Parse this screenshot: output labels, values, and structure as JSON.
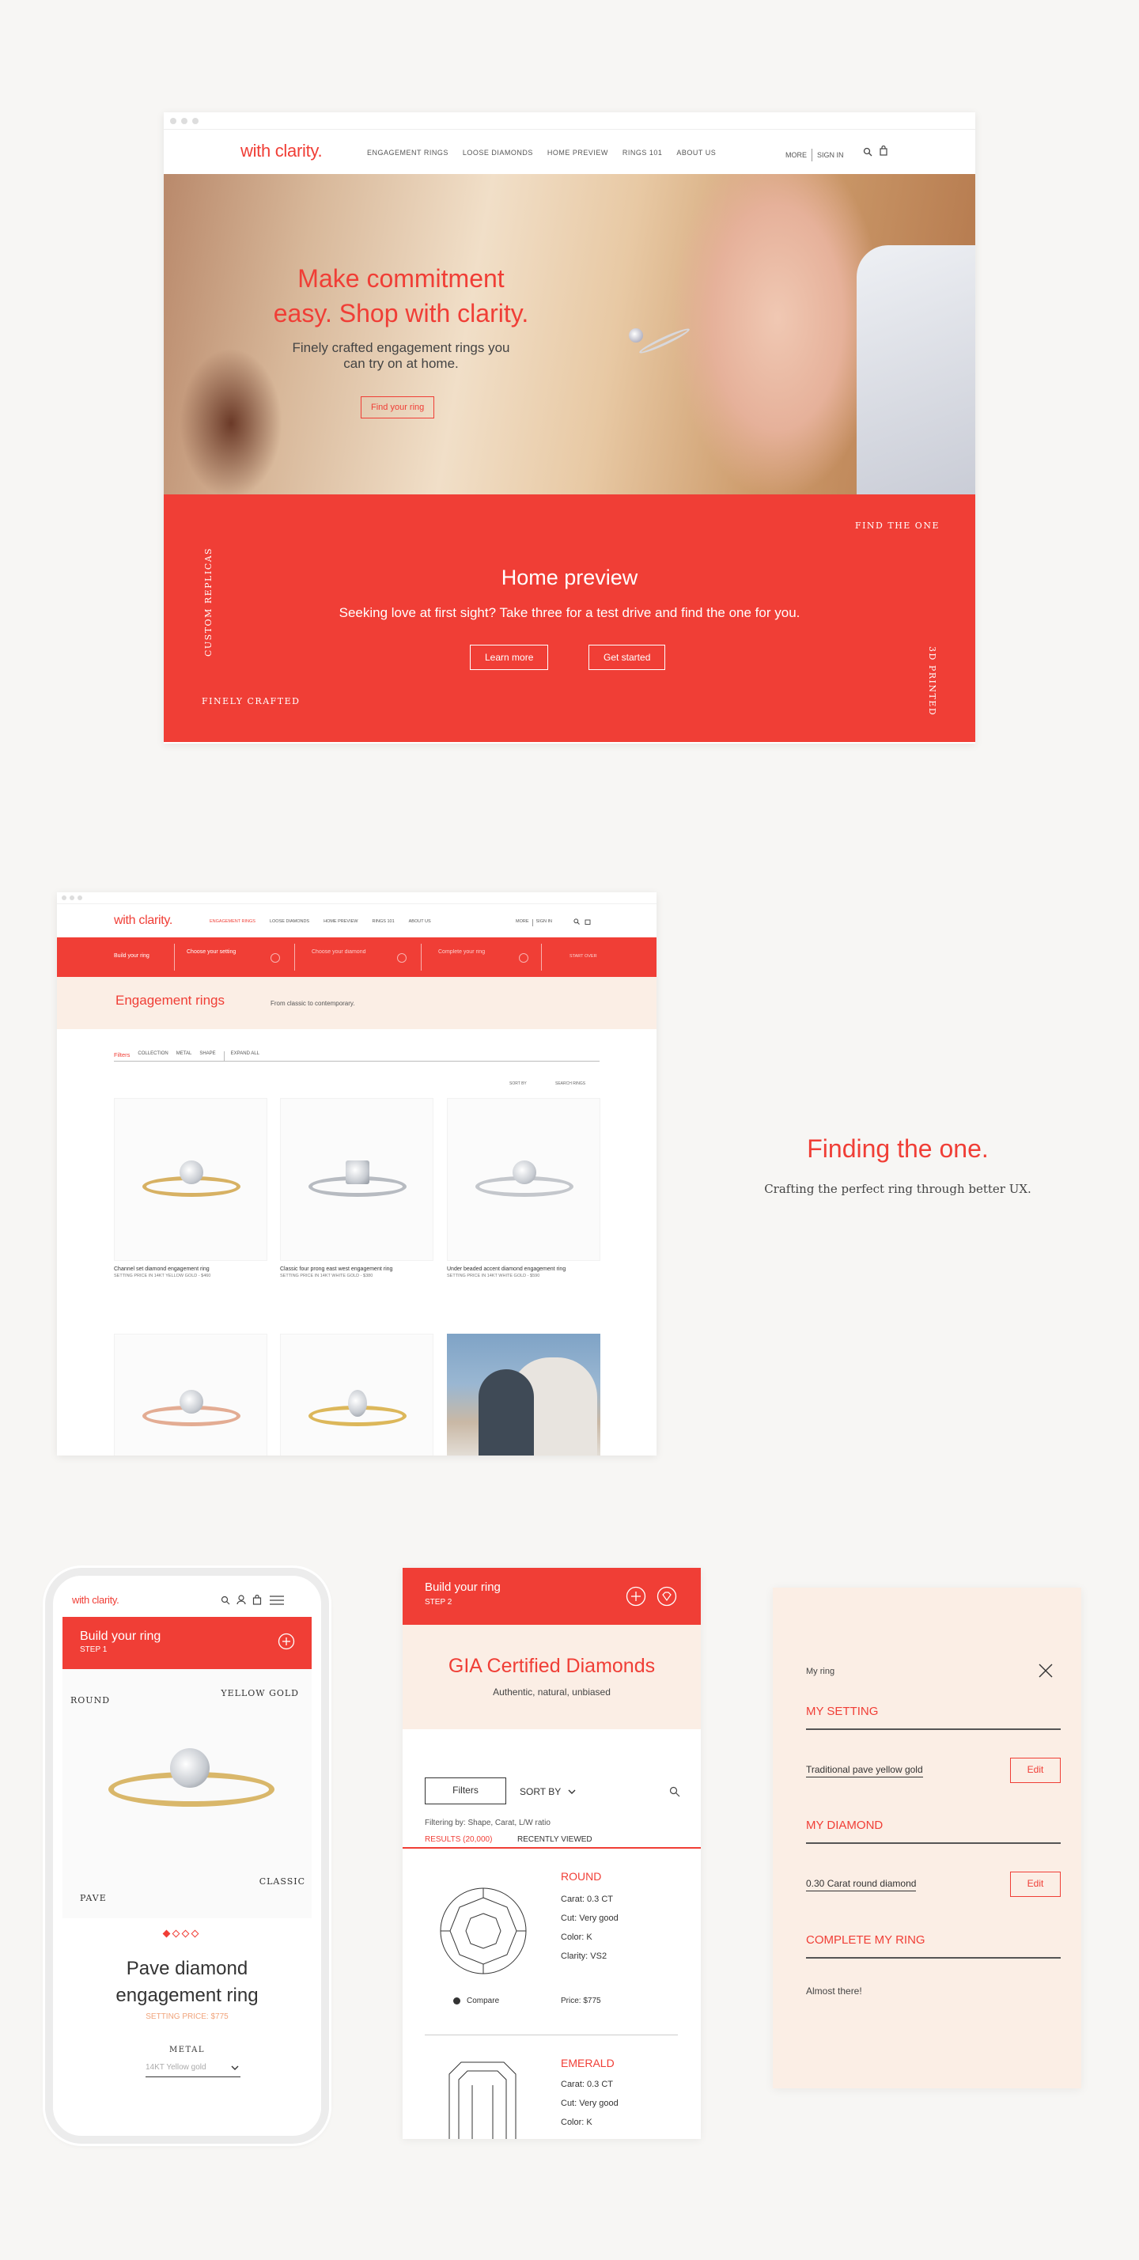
{
  "desktop_home": {
    "logo": "with clarity.",
    "nav": [
      "ENGAGEMENT RINGS",
      "LOOSE DIAMONDS",
      "HOME PREVIEW",
      "RINGS 101",
      "ABOUT US"
    ],
    "more": "MORE",
    "sign_in": "SIGN IN",
    "hero": {
      "headline_1": "Make commitment",
      "headline_2": "easy. Shop with clarity.",
      "sub_1": "Finely crafted engagement rings you",
      "sub_2": "can try on at home.",
      "cta": "Find your ring"
    },
    "preview": {
      "title": "Home preview",
      "text": "Seeking love at first sight? Take three for a test drive and find the one for you.",
      "learn_more": "Learn more",
      "get_started": "Get started",
      "find_the_one": "FIND THE ONE",
      "custom_replicas": "CUSTOM REPLICAS",
      "finely_crafted": "FINELY CRAFTED",
      "printed_3d": "3D PRINTED"
    }
  },
  "desktop_listing": {
    "logo": "with clarity.",
    "nav": [
      "ENGAGEMENT RINGS",
      "LOOSE DIAMONDS",
      "HOME PREVIEW",
      "RINGS 101",
      "ABOUT US"
    ],
    "more": "MORE",
    "sign_in": "SIGN IN",
    "steps": {
      "build": "Build your ring",
      "setting": "Choose your setting",
      "diamond": "Choose your diamond",
      "complete": "Complete your ring",
      "start_over": "START OVER"
    },
    "page_title": "Engagement rings",
    "page_sub": "From classic to contemporary.",
    "filters": [
      "Filters",
      "COLLECTION",
      "METAL",
      "SHAPE",
      "EXPAND ALL"
    ],
    "sort_by": "SORT BY",
    "search_rings": "SEARCH RINGS",
    "products": [
      {
        "name": "Channel set diamond engagement ring",
        "price": "SETTING PRICE IN 14KT YELLOW GOLD - $460"
      },
      {
        "name": "Classic four prong east west engagement ring",
        "price": "SETTING PRICE IN 14KT WHITE GOLD - $380"
      },
      {
        "name": "Under beaded accent diamond engagement ring",
        "price": "SETTING PRICE IN 14KT WHITE GOLD - $590"
      }
    ]
  },
  "tagline": {
    "title": "Finding the one.",
    "sub": "Crafting the perfect ring through better UX."
  },
  "mobile_setting": {
    "logo": "with clarity.",
    "build": "Build your ring",
    "step": "STEP 1",
    "round": "ROUND",
    "yellow_gold": "YELLOW GOLD",
    "classic": "CLASSIC",
    "pave": "PAVE",
    "name_1": "Pave diamond",
    "name_2": "engagement ring",
    "price": "SETTING PRICE: $775",
    "metal_label": "METAL",
    "metal_value": "14KT Yellow gold"
  },
  "mobile_diamonds": {
    "build": "Build your ring",
    "step": "STEP 2",
    "title": "GIA Certified Diamonds",
    "sub": "Authentic, natural, unbiased",
    "filters": "Filters",
    "sort_by": "SORT BY",
    "filtering": "Filtering by: Shape, Carat, L/W ratio",
    "tab_results": "RESULTS (20,000)",
    "tab_recent": "RECENTLY VIEWED",
    "items": [
      {
        "shape": "ROUND",
        "carat": "Carat: 0.3 CT",
        "cut": "Cut: Very good",
        "color": "Color: K",
        "clarity": "Clarity: VS2",
        "price": "Price: $775",
        "compare": "Compare"
      },
      {
        "shape": "EMERALD",
        "carat": "Carat: 0.3 CT",
        "cut": "Cut: Very good",
        "color": "Color: K"
      }
    ]
  },
  "my_ring": {
    "title": "My ring",
    "my_setting": "MY SETTING",
    "setting_value": "Traditional pave yellow gold",
    "my_diamond": "MY DIAMOND",
    "diamond_value": "0.30 Carat round diamond",
    "edit": "Edit",
    "complete": "COMPLETE MY RING",
    "almost": "Almost there!"
  }
}
